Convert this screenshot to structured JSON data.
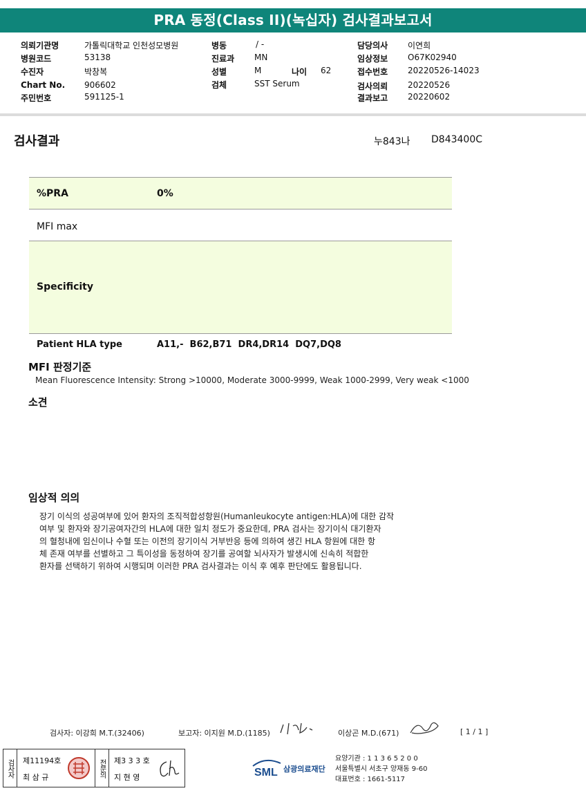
{
  "title": "PRA 동정(Class II)(녹십자) 검사결과보고서",
  "header": {
    "col1": [
      {
        "label": "의뢰기관명",
        "value": "가톨릭대학교 인천성모병원"
      },
      {
        "label": "병원코드",
        "value": "53138"
      },
      {
        "label": "수진자",
        "value": "박창복"
      },
      {
        "label": "Chart No.",
        "value": "906602"
      },
      {
        "label": "주민번호",
        "value": "591125-1"
      }
    ],
    "col2": [
      {
        "label": "병동",
        "value": "/ -"
      },
      {
        "label": "진료과",
        "value": "MN"
      },
      {
        "label": "성별",
        "value": "M"
      },
      {
        "label": "검체",
        "value": "SST Serum"
      }
    ],
    "age": {
      "label": "나이",
      "value": "62"
    },
    "col3": [
      {
        "label": "담당의사",
        "value": "이연희"
      },
      {
        "label": "임상정보",
        "value": "O67K02940"
      },
      {
        "label": "접수번호",
        "value": "20220526-14023"
      },
      {
        "label": "검사의뢰",
        "value": "20220526"
      },
      {
        "label": "결과보고",
        "value": "20220602"
      }
    ]
  },
  "result": {
    "section_title": "검사결과",
    "code1": "누843나",
    "code2": "D843400C",
    "pra_label": "%PRA",
    "pra_value": "0%",
    "mfi_label": "MFI max",
    "mfi_value": "",
    "specificity_label": "Specificity",
    "specificity_value": "",
    "hla_label": "Patient HLA type",
    "hla_value": "A11,-  B62,B71  DR4,DR14  DQ7,DQ8"
  },
  "mfi_criteria": {
    "title": "MFI 판정기준",
    "text": "Mean Fluorescence Intensity: Strong >10000, Moderate 3000-9999, Weak 1000-2999, Very weak <1000"
  },
  "findings": {
    "title": "소견",
    "text": ""
  },
  "clinical": {
    "title": "임상적 의의",
    "lines": [
      "장기 이식의 성공여부에 있어 환자의 조직적합성항원(Humanleukocyte antigen:HLA)에 대한 감작",
      "여부 및 환자와 장기공여자간의 HLA에 대한 일치 정도가 중요한데, PRA 검사는 장기이식 대기환자",
      "의 혈청내에 임신이나 수혈 또는 이전의 장기이식 거부반응 등에 의하여 생긴 HLA 항원에 대한 항",
      "체 존재 여부를 선별하고 그 특이성을 동정하여 장기를 공여할 뇌사자가 발생시에 신속히 적합한",
      "환자를 선택하기 위하여 시행되며 이러한 PRA 검사결과는 이식 후 예후 판단에도 활용됩니다."
    ]
  },
  "footer": {
    "tester": "검사자: 이강희 M.T.(32406)",
    "reporter": "보고자: 이지원 M.D.(1185)",
    "reporter2": "이상곤 M.D.(671)",
    "page": "[ 1 / 1 ]"
  },
  "stamp": {
    "label1": "검사자",
    "reg1": "제11194호",
    "name1": "최 삼 규",
    "label2": "전문의",
    "reg2": "제3 3 3 호",
    "name2": "지 현 영"
  },
  "org": {
    "logo_text": "SML",
    "name": "삼광의료재단",
    "line1": "요양기관 : 1 1 3 6 5 2 0 0",
    "line2": "서울특별시 서초구 양재동 9-60",
    "line3": "대표번호 : 1661-5117",
    "brand_color": "#0f857a"
  }
}
